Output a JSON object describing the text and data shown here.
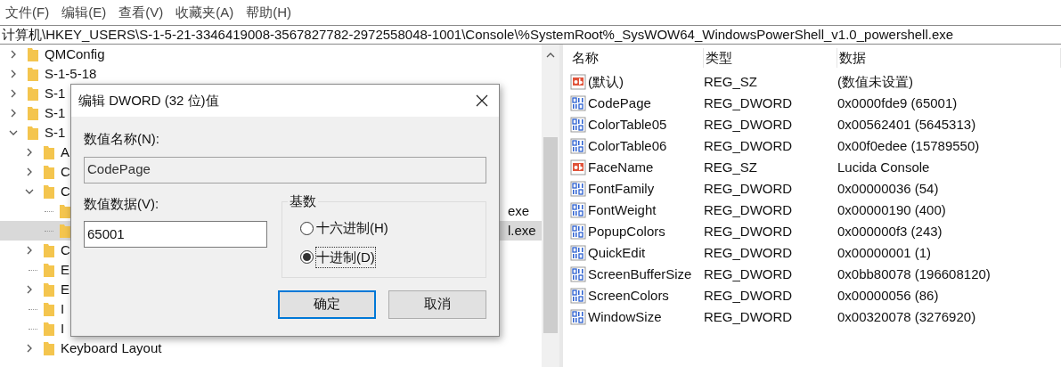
{
  "menu": [
    {
      "label": "文件(F)"
    },
    {
      "label": "编辑(E)"
    },
    {
      "label": "查看(V)"
    },
    {
      "label": "收藏夹(A)"
    },
    {
      "label": "帮助(H)"
    }
  ],
  "address": "计算机\\HKEY_USERS\\S-1-5-21-3346419008-3567827782-2972558048-1001\\Console\\%SystemRoot%_SysWOW64_WindowsPowerShell_v1.0_powershell.exe",
  "tree": [
    {
      "label": "QMConfig",
      "expandable": true,
      "expanded": false,
      "selected": false
    },
    {
      "label": "S-1-5-18",
      "expandable": true,
      "expanded": false,
      "selected": false
    },
    {
      "label": "S-1",
      "expandable": true,
      "expanded": false,
      "selected": false
    },
    {
      "label": "S-1",
      "expandable": true,
      "expanded": false,
      "selected": false
    },
    {
      "label": "S-1",
      "expandable": true,
      "expanded": true,
      "selected": false,
      "children": [
        {
          "label": "A",
          "expandable": true,
          "expanded": false,
          "selected": false
        },
        {
          "label": "C",
          "expandable": true,
          "expanded": false,
          "selected": false
        },
        {
          "label": "C",
          "expandable": true,
          "expanded": true,
          "selected": false,
          "children": [
            {
              "label": "exe",
              "expandable": false,
              "selected": false
            },
            {
              "label": "l.exe",
              "expandable": false,
              "selected": true
            }
          ]
        },
        {
          "label": "C",
          "expandable": true,
          "expanded": false,
          "selected": false
        },
        {
          "label": "E",
          "expandable": false,
          "selected": false
        },
        {
          "label": "E",
          "expandable": true,
          "expanded": false,
          "selected": false
        },
        {
          "label": "I",
          "expandable": false,
          "selected": false
        },
        {
          "label": "I",
          "expandable": false,
          "selected": false
        },
        {
          "label": "Keyboard Layout",
          "expandable": true,
          "expanded": false,
          "selected": false
        }
      ]
    }
  ],
  "values": {
    "columns": [
      "名称",
      "类型",
      "数据"
    ],
    "rows": [
      {
        "kind": "sz",
        "name": "(默认)",
        "type": "REG_SZ",
        "data": "(数值未设置)"
      },
      {
        "kind": "dword",
        "name": "CodePage",
        "type": "REG_DWORD",
        "data": "0x0000fde9 (65001)"
      },
      {
        "kind": "dword",
        "name": "ColorTable05",
        "type": "REG_DWORD",
        "data": "0x00562401 (5645313)"
      },
      {
        "kind": "dword",
        "name": "ColorTable06",
        "type": "REG_DWORD",
        "data": "0x00f0edee (15789550)"
      },
      {
        "kind": "sz",
        "name": "FaceName",
        "type": "REG_SZ",
        "data": "Lucida Console"
      },
      {
        "kind": "dword",
        "name": "FontFamily",
        "type": "REG_DWORD",
        "data": "0x00000036 (54)"
      },
      {
        "kind": "dword",
        "name": "FontWeight",
        "type": "REG_DWORD",
        "data": "0x00000190 (400)"
      },
      {
        "kind": "dword",
        "name": "PopupColors",
        "type": "REG_DWORD",
        "data": "0x000000f3 (243)"
      },
      {
        "kind": "dword",
        "name": "QuickEdit",
        "type": "REG_DWORD",
        "data": "0x00000001 (1)"
      },
      {
        "kind": "dword",
        "name": "ScreenBufferSize",
        "type": "REG_DWORD",
        "data": "0x0bb80078 (196608120)"
      },
      {
        "kind": "dword",
        "name": "ScreenColors",
        "type": "REG_DWORD",
        "data": "0x00000056 (86)"
      },
      {
        "kind": "dword",
        "name": "WindowSize",
        "type": "REG_DWORD",
        "data": "0x00320078 (3276920)"
      }
    ]
  },
  "dialog": {
    "title": "编辑 DWORD (32 位)值",
    "name_label": "数值名称(N):",
    "name_value": "CodePage",
    "data_label": "数值数据(V):",
    "data_value": "65001",
    "base_label": "基数",
    "bases": [
      {
        "label": "十六进制(H)",
        "selected": false
      },
      {
        "label": "十进制(D)",
        "selected": true
      }
    ],
    "buttons": [
      {
        "label": "确定",
        "default": true
      },
      {
        "label": "取消",
        "default": false
      }
    ]
  }
}
